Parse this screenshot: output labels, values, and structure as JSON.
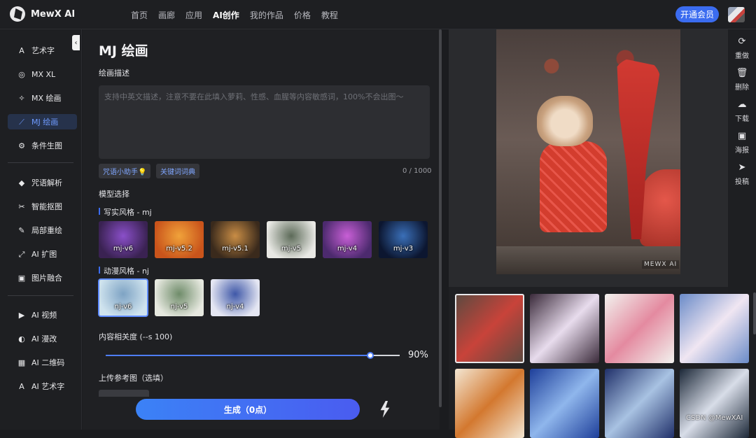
{
  "app": {
    "name": "MewX AI"
  },
  "nav": [
    "首页",
    "画廊",
    "应用",
    "AI创作",
    "我的作品",
    "价格",
    "教程"
  ],
  "nav_active": "AI创作",
  "header": {
    "vip_label": "开通会员"
  },
  "sidebar": {
    "group1": [
      {
        "label": "艺术字",
        "icon": "A"
      },
      {
        "label": "MX XL",
        "icon": "◎"
      },
      {
        "label": "MX 绘画",
        "icon": "✧"
      },
      {
        "label": "MJ 绘画",
        "icon": "⟋"
      },
      {
        "label": "条件生图",
        "icon": "⚙"
      }
    ],
    "group2": [
      {
        "label": "咒语解析",
        "icon": "◆"
      },
      {
        "label": "智能抠图",
        "icon": "✂"
      },
      {
        "label": "局部重绘",
        "icon": "✎"
      },
      {
        "label": "AI 扩图",
        "icon": "⤢"
      },
      {
        "label": "图片融合",
        "icon": "▣"
      }
    ],
    "group3": [
      {
        "label": "AI 视频",
        "icon": "▶"
      },
      {
        "label": "AI 漫改",
        "icon": "◐"
      },
      {
        "label": "AI 二维码",
        "icon": "▦"
      },
      {
        "label": "AI 艺术字",
        "icon": "A"
      }
    ],
    "active": "MJ 绘画"
  },
  "form": {
    "title": "MJ 绘画",
    "prompt_label": "绘画描述",
    "prompt_placeholder": "支持中英文描述，注意不要在此填入萝莉、性感、血腥等内容敏感词，100%不会出图～",
    "prompt_value": "",
    "chip_helper": "咒语小助手💡",
    "chip_dict": "关键词词典",
    "counter": "0 / 1000",
    "model_label": "模型选择",
    "realistic_label": "写实风格 - mj",
    "realistic_models": [
      {
        "name": "mj-v6",
        "c1": "#3a2252",
        "c2": "#8a4fc9"
      },
      {
        "name": "mj-v5.2",
        "c1": "#c9541b",
        "c2": "#f0a23a"
      },
      {
        "name": "mj-v5.1",
        "c1": "#3a2a1c",
        "c2": "#c98d45"
      },
      {
        "name": "mj-v5",
        "c1": "#e8e8e4",
        "c2": "#5c6a58"
      },
      {
        "name": "mj-v4",
        "c1": "#4c2a6e",
        "c2": "#c85fd6"
      },
      {
        "name": "mj-v3",
        "c1": "#0c1630",
        "c2": "#3a6fb8"
      }
    ],
    "anime_label": "动漫风格 - nj",
    "anime_models": [
      {
        "name": "nj-v6",
        "c1": "#cfe3ee",
        "c2": "#7ea3c4",
        "selected": true
      },
      {
        "name": "nj-v5",
        "c1": "#e6e8df",
        "c2": "#6f8c6a",
        "selected": false
      },
      {
        "name": "nj-v4",
        "c1": "#e4e6f2",
        "c2": "#3f58a8",
        "selected": false
      }
    ],
    "relevance_label": "内容相关度 (--s 100)",
    "relevance_value": 0.9,
    "relevance_text": "90%",
    "upload_label": "上传参考图（选填）",
    "generate_label": "生成（0点）"
  },
  "preview": {
    "watermark": "MEWX AI"
  },
  "tools": [
    {
      "label": "重做",
      "icon": "⟳"
    },
    {
      "label": "删除",
      "icon": "🗑"
    },
    {
      "label": "下载",
      "icon": "☁"
    },
    {
      "label": "海报",
      "icon": "▣"
    },
    {
      "label": "投稿",
      "icon": "➤"
    }
  ],
  "gallery": [
    {
      "c1": "#5a4a40",
      "c2": "#c8433a",
      "selected": true
    },
    {
      "c1": "#3a2a3a",
      "c2": "#e8dced",
      "selected": false
    },
    {
      "c1": "#f2f2ee",
      "c2": "#e48aa0",
      "selected": false
    },
    {
      "c1": "#6a8bc8",
      "c2": "#f0e6f2",
      "selected": false
    },
    {
      "c1": "#f3e6d2",
      "c2": "#d3782f",
      "selected": false
    },
    {
      "c1": "#1e3f9a",
      "c2": "#8fb6ec",
      "selected": false
    },
    {
      "c1": "#20306a",
      "c2": "#a8c2e2",
      "selected": false
    },
    {
      "c1": "#1c2838",
      "c2": "#d8dde8",
      "selected": false
    }
  ],
  "footer_watermark": "CSDN @MewXAI"
}
